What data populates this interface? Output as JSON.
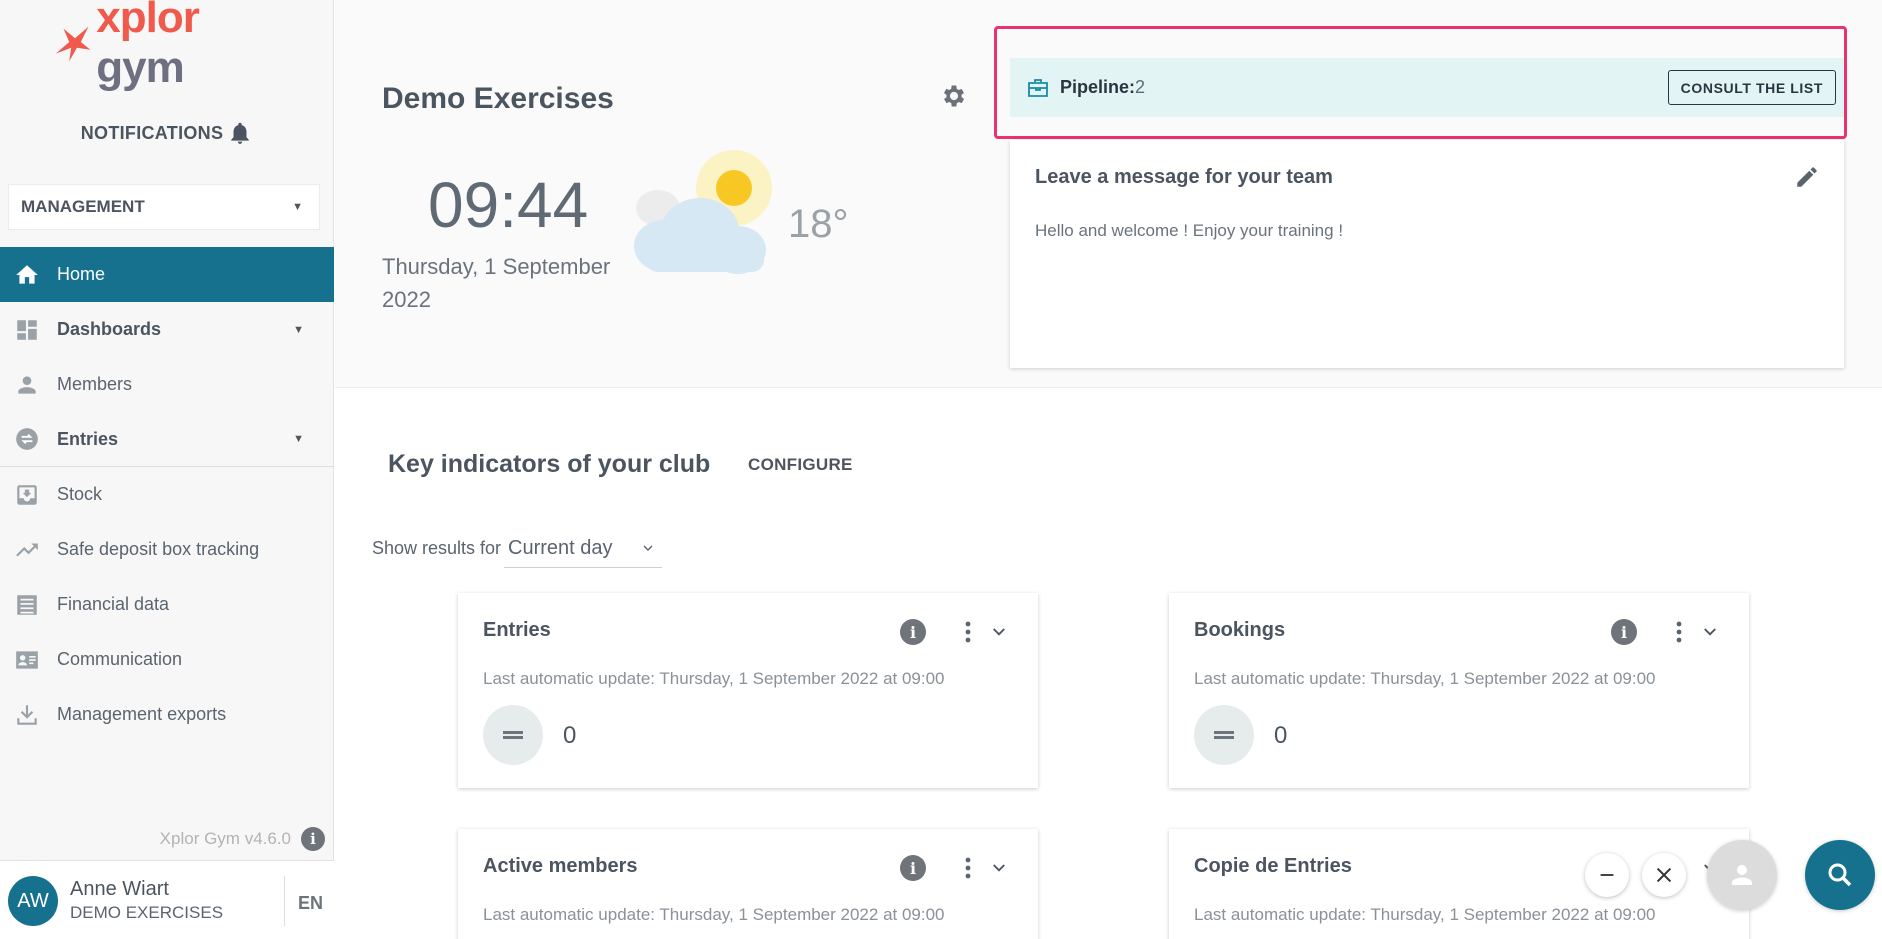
{
  "sidebar": {
    "logo": "xplor gym",
    "notifications_label": "NOTIFICATIONS",
    "management_select": "MANAGEMENT",
    "items": [
      {
        "label": "Home",
        "icon": "home-icon"
      },
      {
        "label": "Dashboards",
        "icon": "dashboard-icon"
      },
      {
        "label": "Members",
        "icon": "person-icon"
      },
      {
        "label": "Entries",
        "icon": "swap-icon"
      },
      {
        "label": "Stock",
        "icon": "inbox-download-icon"
      },
      {
        "label": "Safe deposit box tracking",
        "icon": "trending-up-icon"
      },
      {
        "label": "Financial data",
        "icon": "receipt-icon"
      },
      {
        "label": "Communication",
        "icon": "contact-card-icon"
      },
      {
        "label": "Management exports",
        "icon": "download-icon"
      }
    ],
    "version": "Xplor Gym v4.6.0",
    "user": {
      "initials": "AW",
      "name": "Anne Wiart",
      "club": "DEMO EXERCISES",
      "lang": "EN"
    }
  },
  "header": {
    "club_title": "Demo Exercises",
    "time": "09:44",
    "date": "Thursday, 1 September 2022",
    "temperature": "18°",
    "pipeline_label": "Pipeline:",
    "pipeline_count": "2",
    "consult_button": "CONSULT THE LIST",
    "message_title": "Leave a message for your team",
    "message_text": "Hello and welcome ! Enjoy your training !"
  },
  "indicators": {
    "title": "Key indicators of your club",
    "configure": "CONFIGURE",
    "show_results_label": "Show results for",
    "period": "Current day",
    "cards": [
      {
        "title": "Entries",
        "update": "Last automatic update: Thursday, 1 September 2022 at 09:00",
        "value": "0"
      },
      {
        "title": "Bookings",
        "update": "Last automatic update: Thursday, 1 September 2022 at 09:00",
        "value": "0"
      },
      {
        "title": "Active members",
        "update": "Last automatic update: Thursday, 1 September 2022 at 09:00",
        "value": ""
      },
      {
        "title": "Copie de Entries",
        "update": "Last automatic update: Thursday, 1 September 2022 at 09:00",
        "value": ""
      }
    ]
  },
  "colors": {
    "primary": "#16718e",
    "brand_orange": "#ef5a4c",
    "highlight": "#e8336f",
    "pipeline_bg": "#e3f4f4"
  }
}
